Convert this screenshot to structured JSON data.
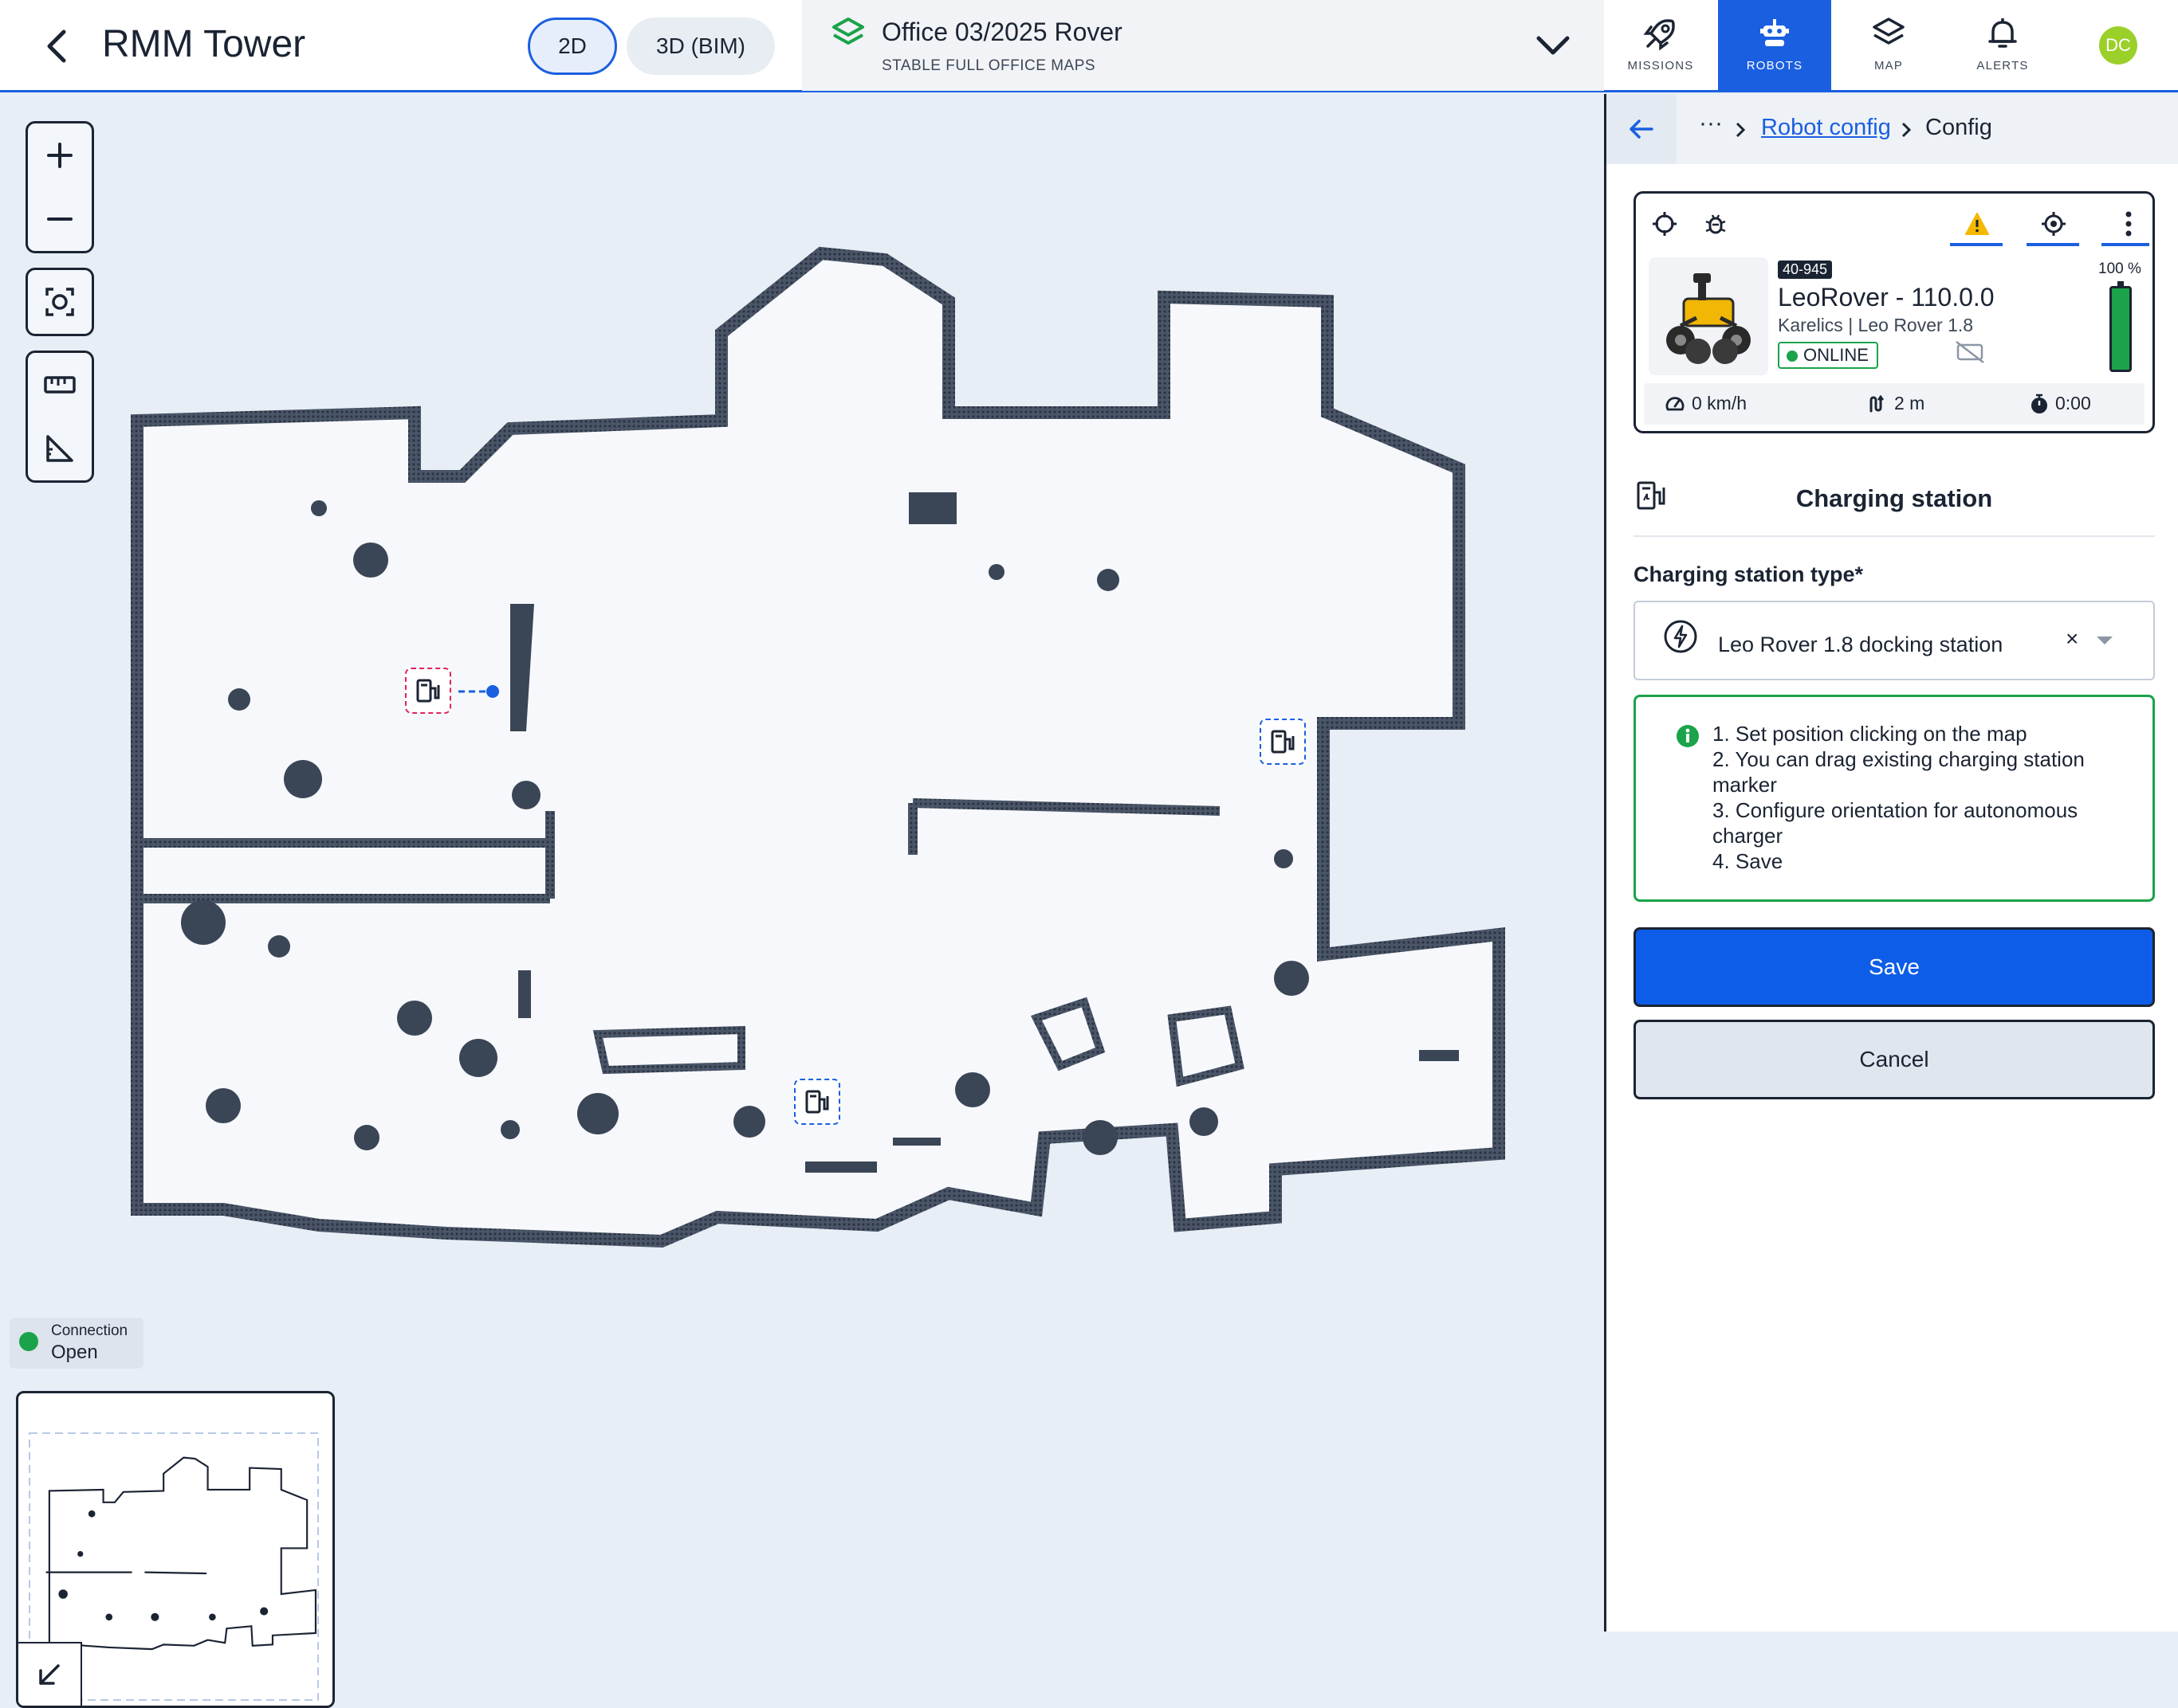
{
  "header": {
    "title": "RMM Tower",
    "view_2d": "2D",
    "view_3d": "3D (BIM)",
    "map_name": "Office 03/2025 Rover",
    "map_subtitle": "STABLE FULL OFFICE MAPS",
    "nav": [
      {
        "label": "MISSIONS",
        "icon": "rocket-icon",
        "active": false
      },
      {
        "label": "ROBOTS",
        "icon": "robot-icon",
        "active": true
      },
      {
        "label": "MAP",
        "icon": "layers-icon",
        "active": false
      },
      {
        "label": "ALERTS",
        "icon": "bell-icon",
        "active": false
      }
    ],
    "avatar": "DC",
    "accent": "#1a5fe0"
  },
  "map": {
    "connection_label": "Connection",
    "connection_status": "Open",
    "connection_color": "#1aa34a",
    "tools": [
      "zoom-in-icon",
      "zoom-out-icon",
      "fit-screen-icon",
      "ruler-icon",
      "angle-icon"
    ]
  },
  "panel": {
    "breadcrumb": {
      "ellipsis": "···",
      "link": "Robot config",
      "current": "Config"
    },
    "robot": {
      "id": "40-945",
      "name": "LeoRover - 110.0.0",
      "model": "Karelics | Leo Rover 1.8",
      "status": "ONLINE",
      "battery": "100 %",
      "battery_level": 1.0,
      "speed": "0 km/h",
      "distance": "2 m",
      "time": "0:00"
    },
    "section_title": "Charging station",
    "field_label": "Charging station type*",
    "field_value": "Leo Rover 1.8 docking station",
    "clear_symbol": "×",
    "instructions": [
      "1. Set position clicking on the map",
      "2. You can drag existing charging station marker",
      "3. Configure orientation for autonomous charger",
      "4. Save"
    ],
    "save_label": "Save",
    "cancel_label": "Cancel"
  }
}
